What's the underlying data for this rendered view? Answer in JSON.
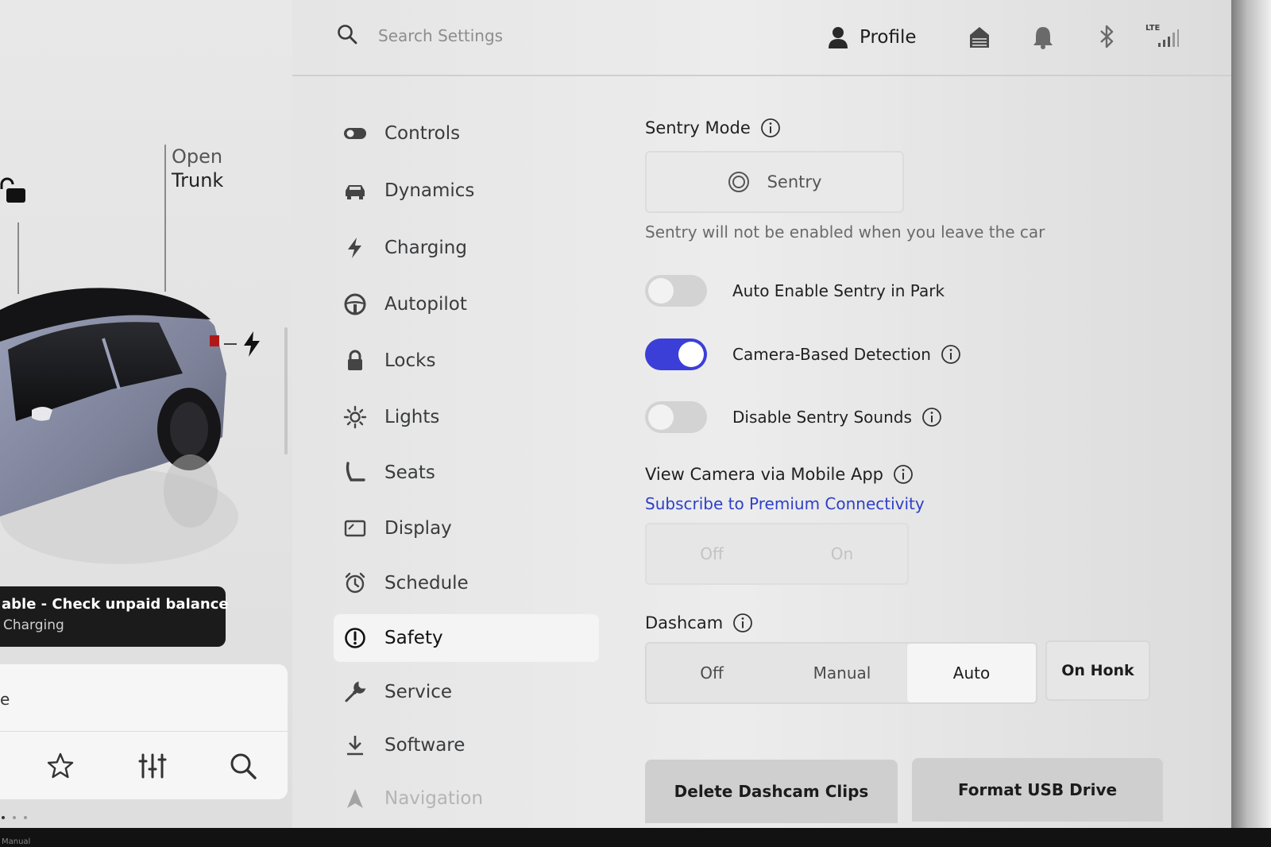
{
  "header": {
    "search_placeholder": "Search Settings",
    "profile_label": "Profile",
    "icons": [
      "search-icon",
      "profile-icon",
      "homelink-icon",
      "notification-bell-icon",
      "bluetooth-icon",
      "lte-signal-icon"
    ],
    "lte_label": "LTE"
  },
  "car_panel": {
    "open_trunk_line1": "Open",
    "open_trunk_line2": "Trunk",
    "toast_line1": "able - Check unpaid balance",
    "toast_line2": "Charging",
    "card_fragment": "e",
    "bottom_icons": [
      "favorite-star-icon",
      "controls-sliders-icon",
      "search-icon"
    ],
    "bezel_text": "Manual"
  },
  "nav": {
    "items": [
      {
        "label": "Controls",
        "icon": "toggle-icon"
      },
      {
        "label": "Dynamics",
        "icon": "car-icon"
      },
      {
        "label": "Charging",
        "icon": "bolt-icon"
      },
      {
        "label": "Autopilot",
        "icon": "steering-wheel-icon"
      },
      {
        "label": "Locks",
        "icon": "lock-icon"
      },
      {
        "label": "Lights",
        "icon": "sun-icon"
      },
      {
        "label": "Seats",
        "icon": "seat-icon"
      },
      {
        "label": "Display",
        "icon": "display-icon"
      },
      {
        "label": "Schedule",
        "icon": "alarm-clock-icon"
      },
      {
        "label": "Safety",
        "icon": "alert-circle-icon",
        "selected": true
      },
      {
        "label": "Service",
        "icon": "wrench-icon"
      },
      {
        "label": "Software",
        "icon": "download-icon"
      },
      {
        "label": "Navigation",
        "icon": "navigation-icon"
      }
    ]
  },
  "content": {
    "sentry_mode": {
      "title": "Sentry Mode",
      "button_label": "Sentry",
      "note": "Sentry will not be enabled when you leave the car"
    },
    "toggles": [
      {
        "label": "Auto Enable Sentry in Park",
        "on": false,
        "info": false
      },
      {
        "label": "Camera-Based Detection",
        "on": true,
        "info": true
      },
      {
        "label": "Disable Sentry Sounds",
        "on": false,
        "info": true
      }
    ],
    "view_camera": {
      "title": "View Camera via Mobile App",
      "link": "Subscribe to Premium Connectivity",
      "options": [
        "Off",
        "On"
      ]
    },
    "dashcam": {
      "title": "Dashcam",
      "options": [
        "Off",
        "Manual",
        "Auto"
      ],
      "selected": "Auto",
      "on_honk": "On Honk"
    },
    "buttons": {
      "delete_clips": "Delete Dashcam Clips",
      "format_usb": "Format USB Drive"
    }
  },
  "colors": {
    "accent": "#3b3fd8",
    "link": "#2d3fc9",
    "toast_bg": "#1b1b1c"
  }
}
